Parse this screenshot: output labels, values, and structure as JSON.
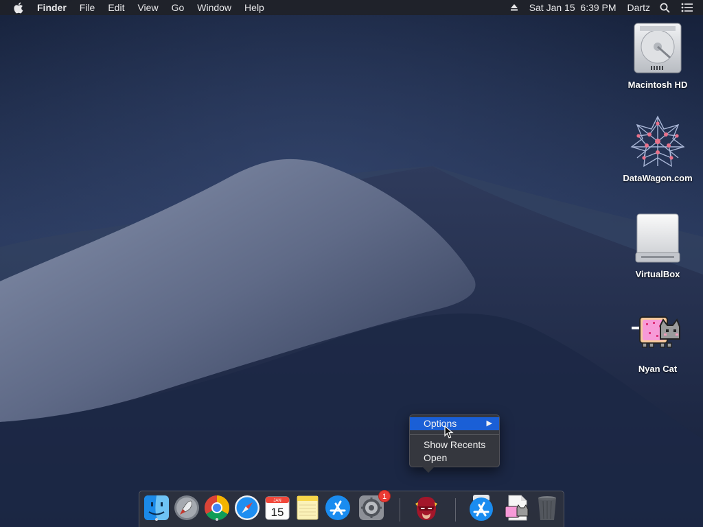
{
  "menubar": {
    "app_name": "Finder",
    "items": [
      "File",
      "Edit",
      "View",
      "Go",
      "Window",
      "Help"
    ],
    "clock": "Sat Jan 15  6:39 PM",
    "user": "Dartz",
    "icons": [
      "apple-icon",
      "eject-icon",
      "spotlight-icon",
      "notification-center-icon"
    ]
  },
  "desktop": {
    "icons": [
      {
        "label": "Macintosh HD",
        "icon": "hard-drive-icon"
      },
      {
        "label": "DataWagon.com",
        "icon": "star-network-icon"
      },
      {
        "label": "VirtualBox",
        "icon": "removable-drive-icon"
      },
      {
        "label": "Nyan Cat",
        "icon": "nyan-cat-icon"
      }
    ]
  },
  "context_menu": {
    "items": [
      {
        "label": "Options",
        "highlighted": true,
        "submenu": true
      },
      {
        "label": "Show Recents",
        "highlighted": false
      },
      {
        "label": "Open",
        "highlighted": false
      }
    ],
    "submenu_arrow": "▶"
  },
  "dock": {
    "apps": [
      {
        "name": "Finder",
        "icon": "finder-icon",
        "running": true
      },
      {
        "name": "Launchpad",
        "icon": "launchpad-icon",
        "running": false
      },
      {
        "name": "Google Chrome",
        "icon": "chrome-icon",
        "running": true
      },
      {
        "name": "Safari",
        "icon": "safari-icon",
        "running": false
      },
      {
        "name": "Calendar",
        "icon": "calendar-icon",
        "running": false,
        "month": "JAN",
        "day": "15"
      },
      {
        "name": "Notes",
        "icon": "notes-icon",
        "running": false
      },
      {
        "name": "App Store",
        "icon": "app-store-icon",
        "running": false
      },
      {
        "name": "System Preferences",
        "icon": "system-preferences-icon",
        "running": false,
        "badge": "1"
      },
      {
        "name": "Flash",
        "icon": "flash-hero-icon",
        "running": false
      },
      {
        "name": "App Store Download",
        "icon": "app-store-download-icon",
        "running": false
      },
      {
        "name": "Nyan Cat Document",
        "icon": "nyan-cat-document-icon",
        "running": false
      },
      {
        "name": "Trash",
        "icon": "trash-icon",
        "running": false
      }
    ]
  },
  "colors": {
    "menu_highlight": "#1a5fd6",
    "badge": "#ea3b35",
    "sky_top": "#16233f",
    "dune": "#6f7a95"
  }
}
